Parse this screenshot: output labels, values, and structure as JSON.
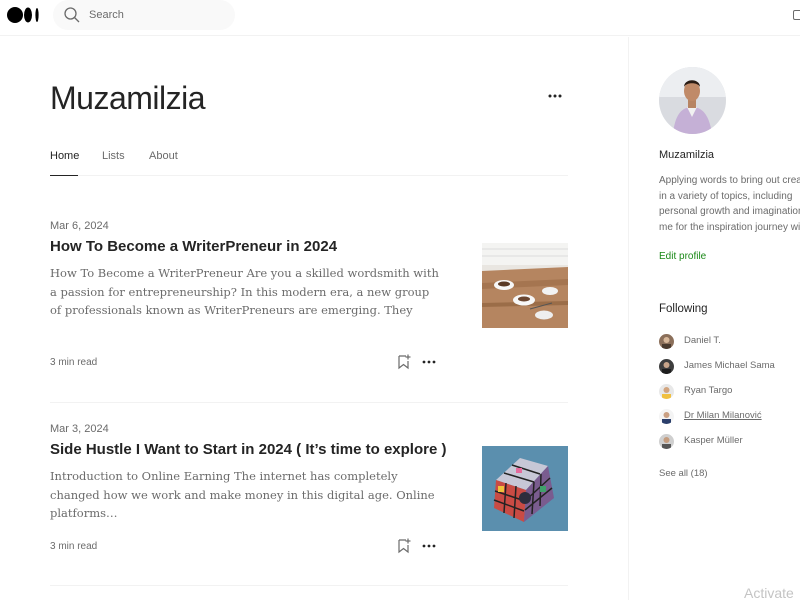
{
  "topbar": {
    "search_placeholder": "Search",
    "logo_icon": "medium-logo-icon",
    "search_icon": "search-icon"
  },
  "profile": {
    "title": "Muzamilzia",
    "more_icon": "more-horizontal-icon",
    "tabs": [
      {
        "label": "Home",
        "active": true
      },
      {
        "label": "Lists",
        "active": false
      },
      {
        "label": "About",
        "active": false
      }
    ]
  },
  "articles": [
    {
      "date": "Mar 6, 2024",
      "title": "How To Become a WriterPreneur in 2024",
      "excerpt": "How To Become a WriterPreneur Are you a skilled wordsmith with a passion for entrepreneurship? In this modern era, a new group of professionals known as WriterPreneurs are emerging. They combine…",
      "read_time": "3 min read",
      "thumb": "coffee-cups-on-table-image"
    },
    {
      "date": "Mar 3, 2024",
      "title": "Side Hustle I Want to Start in 2024 ( It’s time to explore )",
      "excerpt": "Introduction to Online Earning The internet has completely changed how we work and make money in this digital age. Online platforms…",
      "read_time": "3 min read",
      "thumb": "rubiks-cube-image"
    }
  ],
  "sidebar": {
    "name": "Muzamilzia",
    "bio": "Applying words to bring out creativity in a variety of topics, including personal growth and imagination. Join me for the inspiration journey with me.",
    "edit_profile": "Edit profile",
    "following_heading": "Following",
    "following": [
      {
        "name": "Daniel T.",
        "underline": false
      },
      {
        "name": "James Michael Sama",
        "underline": false
      },
      {
        "name": "Ryan Targo",
        "underline": false
      },
      {
        "name": "Dr Milan Milanović",
        "underline": true
      },
      {
        "name": "Kasper Müller",
        "underline": false
      }
    ],
    "see_all": "See all (18)"
  },
  "watermark": "Activate",
  "colors": {
    "accent_green": "#1a8917",
    "text_primary": "#242424",
    "text_secondary": "#6b6b6b"
  }
}
